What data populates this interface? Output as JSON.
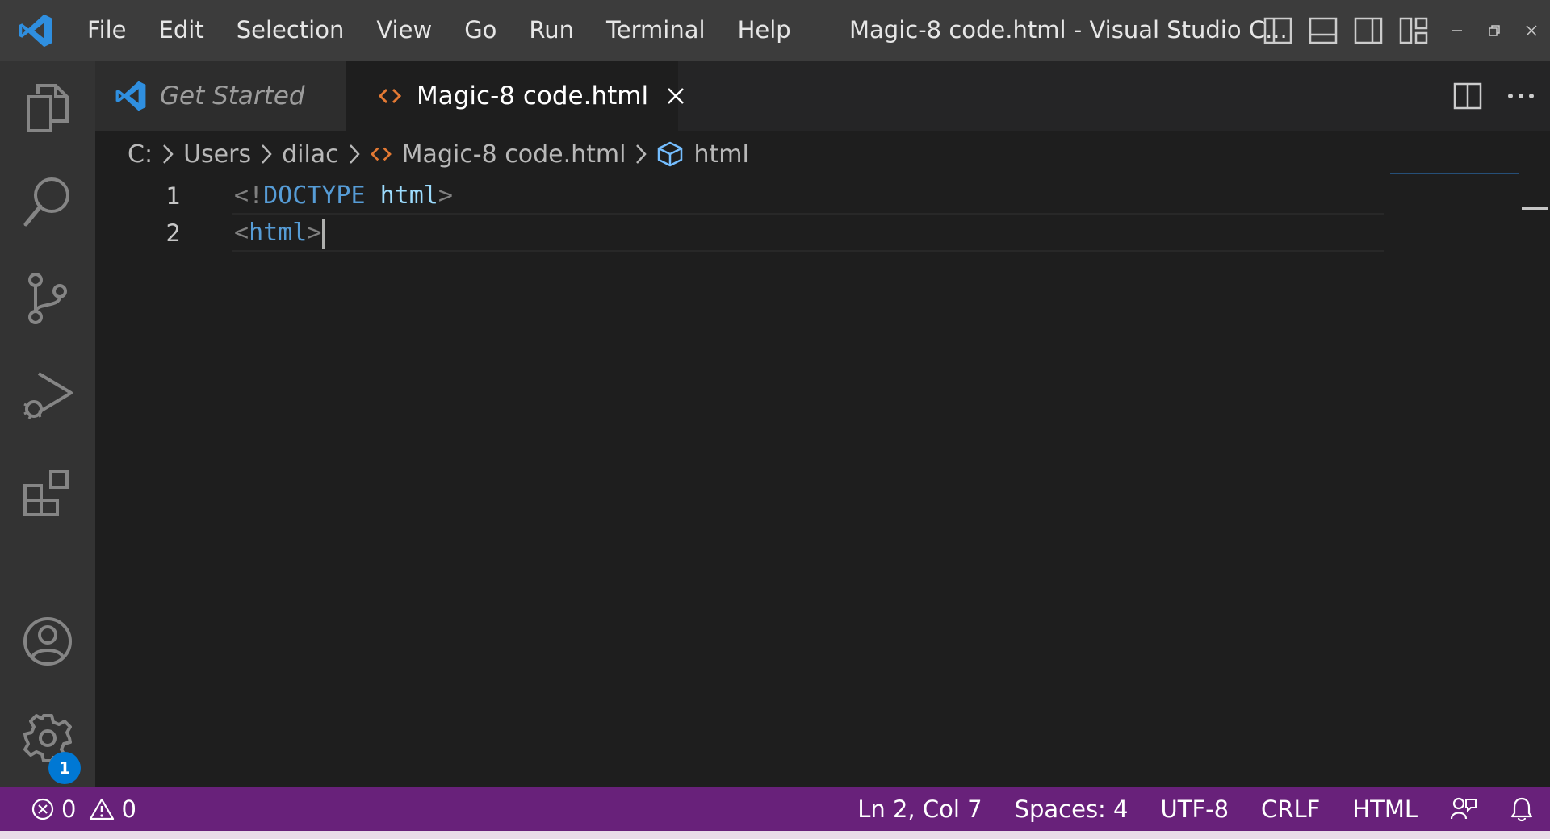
{
  "window": {
    "title": "Magic-8 code.html - Visual Studio C...",
    "menu": [
      "File",
      "Edit",
      "Selection",
      "View",
      "Go",
      "Run",
      "Terminal",
      "Help"
    ]
  },
  "tabs": [
    {
      "label": "Get Started",
      "active": false
    },
    {
      "label": "Magic-8 code.html",
      "active": true
    }
  ],
  "breadcrumb": {
    "drive": "C:",
    "folder1": "Users",
    "folder2": "dilac",
    "file": "Magic-8 code.html",
    "symbol": "html"
  },
  "editor": {
    "lines": [
      {
        "number": "1",
        "open": "<!",
        "keyword": "DOCTYPE",
        "space": " ",
        "tag": "html",
        "close": ">"
      },
      {
        "number": "2",
        "open": "<",
        "tag": "html",
        "close": ">"
      }
    ]
  },
  "activity": {
    "settings_badge": "1"
  },
  "status": {
    "errors": "0",
    "warnings": "0",
    "position": "Ln 2, Col 7",
    "spaces": "Spaces: 4",
    "encoding": "UTF-8",
    "eol": "CRLF",
    "language": "HTML"
  },
  "colors": {
    "status_bar": "#68217a",
    "accent": "#0078d4",
    "keyword": "#569cd6"
  }
}
